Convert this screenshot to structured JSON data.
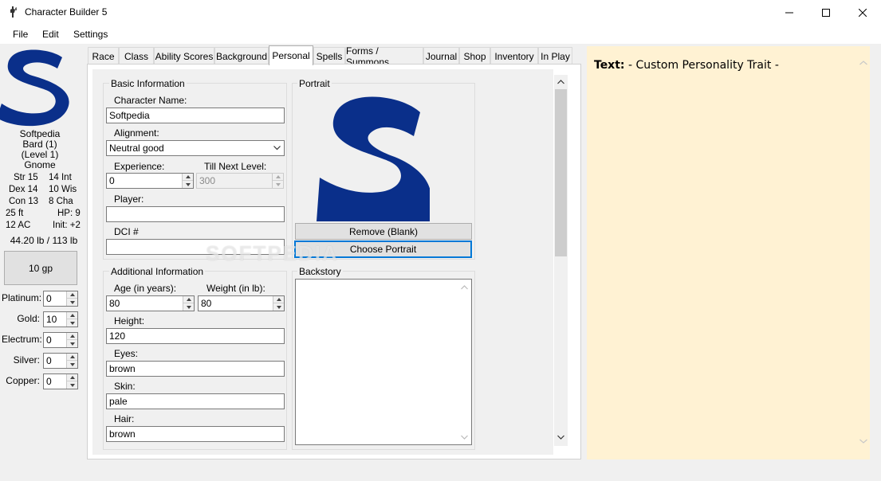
{
  "window": {
    "title": "Character Builder 5"
  },
  "menu": [
    "File",
    "Edit",
    "Settings"
  ],
  "colors": {
    "logo": "#0a2f8a",
    "notes_bg": "#fff2d3",
    "window_bg": "#f0f0f0"
  },
  "character": {
    "name": "Softpedia",
    "class_line": "Bard (1)",
    "level_line": "(Level 1)",
    "race": "Gnome",
    "stats": {
      "str": "Str 15",
      "int": "14 Int",
      "dex": "Dex 14",
      "wis": "10 Wis",
      "con": "Con 13",
      "cha": "8 Cha",
      "speed": "25 ft",
      "hp": "HP: 9",
      "ac": "12 AC",
      "init": "Init: +2",
      "weight": "44.20 lb / 113 lb"
    },
    "gold_total": "10 gp",
    "coins": [
      {
        "label": "Platinum:",
        "value": "0"
      },
      {
        "label": "Gold:",
        "value": "10"
      },
      {
        "label": "Electrum:",
        "value": "0"
      },
      {
        "label": "Silver:",
        "value": "0"
      },
      {
        "label": "Copper:",
        "value": "0"
      }
    ]
  },
  "tabs": [
    {
      "label": "Race",
      "active": false
    },
    {
      "label": "Class",
      "active": false
    },
    {
      "label": "Ability Scores",
      "active": false
    },
    {
      "label": "Background",
      "active": false
    },
    {
      "label": "Personal",
      "active": true
    },
    {
      "label": "Spells",
      "active": false
    },
    {
      "label": "Forms / Summons",
      "active": false
    },
    {
      "label": "Journal",
      "active": false
    },
    {
      "label": "Shop",
      "active": false
    },
    {
      "label": "Inventory",
      "active": false
    },
    {
      "label": "In Play",
      "active": false
    }
  ],
  "basic": {
    "title": "Basic Information",
    "name_label": "Character Name:",
    "name_value": "Softpedia",
    "alignment_label": "Alignment:",
    "alignment_value": "Neutral good",
    "experience_label": "Experience:",
    "experience_value": "0",
    "next_level_label": "Till Next Level:",
    "next_level_value": "300",
    "player_label": "Player:",
    "player_value": "",
    "dci_label": "DCI #",
    "dci_value": ""
  },
  "portrait": {
    "title": "Portrait",
    "remove_label": "Remove (Blank)",
    "choose_label": "Choose Portrait"
  },
  "additional": {
    "title": "Additional Information",
    "age_label": "Age (in years):",
    "age_value": "80",
    "weight_label": "Weight (in lb):",
    "weight_value": "80",
    "height_label": "Height:",
    "height_value": "120",
    "eyes_label": "Eyes:",
    "eyes_value": "brown",
    "skin_label": "Skin:",
    "skin_value": "pale",
    "hair_label": "Hair:",
    "hair_value": "brown"
  },
  "backstory": {
    "title": "Backstory",
    "value": ""
  },
  "notes": {
    "prefix": "Text:",
    "body": "- Custom Personality Trait -"
  },
  "watermark": "SOFTPEDIA"
}
